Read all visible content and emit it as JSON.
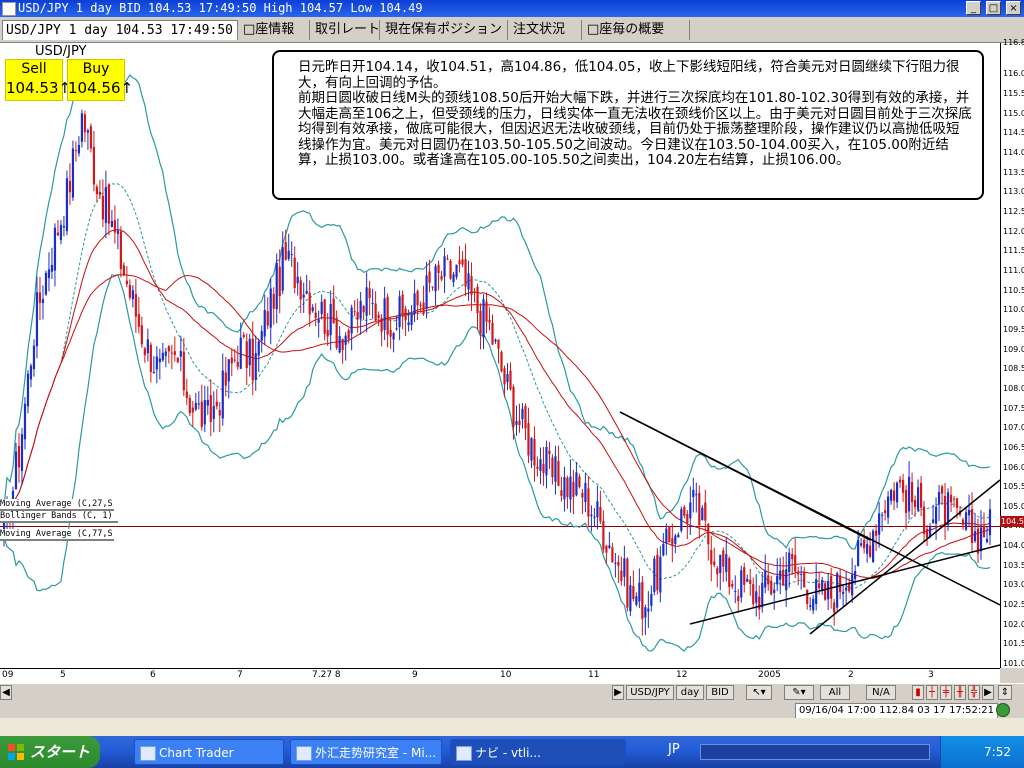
{
  "window": {
    "title": "USD/JPY 1 day BID 104.53 17:49:50 High 104.57 Low 104.49"
  },
  "tabs": [
    {
      "label": "USD/JPY 1 day 104.53 17:49:50"
    },
    {
      "label": "□座情報"
    },
    {
      "label": "取引レート"
    },
    {
      "label": "現在保有ポジション"
    },
    {
      "label": "注文状況"
    },
    {
      "label": "□座毎の概要"
    }
  ],
  "quote": {
    "symbol": "USD/JPY",
    "sell_label": "Sell",
    "sell_value": "104.53↑",
    "buy_label": "Buy",
    "buy_value": "104.56↑"
  },
  "note": {
    "paragraphs": [
      "日元昨日开104.14，收104.51，高104.86，低104.05，收上下影线短阳线，符合美元对日圆继续下行阻力很大，有向上回调的予估。",
      "前期日圆收破日线M头的颈线108.50后开始大幅下跌，并进行三次探底均在101.80-102.30得到有效的承接，并大幅走高至106之上，但受颈线的压力，日线实体一直无法收在颈线价区以上。由于美元对日圆目前处于三次探底均得到有效承接，做底可能很大，但因迟迟无法收破颈线，目前仍处于振荡整理阶段，操作建议仍以高抛低吸短线操作为宜。美元对日圆仍在103.50-105.50之间波动。今日建议在103.50-104.00买入，在105.00附近结算，止损103.00。或者逢高在105.00-105.50之间卖出，104.20左右结算，止损106.00。"
    ]
  },
  "indicators": [
    {
      "label": "Moving Average (C,27,S"
    },
    {
      "label": "Bollinger Bands (C, 1)"
    },
    {
      "label": "Moving Average (C,77,S"
    }
  ],
  "y_axis": {
    "ticks": [
      "116.8",
      "116.0",
      "115.5",
      "115.0",
      "114.5",
      "114.0",
      "113.5",
      "113.0",
      "112.5",
      "112.0",
      "111.5",
      "111.0",
      "110.5",
      "110.0",
      "109.5",
      "109.0",
      "108.5",
      "108.0",
      "107.5",
      "107.0",
      "106.5",
      "106.0",
      "105.5",
      "105.0",
      "104.5",
      "104.0",
      "103.5",
      "103.0",
      "102.5",
      "102.0",
      "101.5",
      "101.0"
    ],
    "current_price": "104.5"
  },
  "x_axis": {
    "ticks": [
      "09",
      "5",
      "6",
      "7",
      "7.27 8",
      "9",
      "10",
      "11",
      "12",
      "2005",
      "2",
      "3"
    ]
  },
  "chart_data": {
    "type": "candlestick",
    "symbol": "USD/JPY",
    "timeframe": "1 day",
    "ylim": [
      100.9,
      116.8
    ],
    "x_labels": [
      "09",
      "5",
      "6",
      "7",
      "7.27 8",
      "9",
      "10",
      "11",
      "12",
      "2005",
      "2",
      "3"
    ],
    "close_series": [
      104.2,
      106.5,
      109.8,
      111.5,
      112.9,
      115.0,
      113.2,
      112.0,
      110.5,
      109.2,
      108.4,
      108.8,
      107.6,
      107.2,
      108.0,
      109.1,
      108.6,
      110.2,
      111.3,
      110.8,
      110.1,
      109.6,
      109.4,
      110.2,
      110.0,
      109.8,
      109.9,
      110.5,
      110.9,
      111.0,
      110.2,
      109.6,
      108.2,
      107.1,
      106.4,
      105.8,
      105.6,
      105.4,
      104.7,
      103.8,
      102.8,
      102.6,
      103.6,
      104.6,
      105.1,
      104.2,
      103.4,
      103.0,
      102.8,
      103.0,
      103.6,
      103.2,
      102.7,
      102.8,
      103.4,
      103.9,
      105.0,
      105.6,
      105.2,
      104.7,
      105.0,
      104.6,
      104.3,
      104.5
    ],
    "indicators": [
      "Moving Average (C,27,S",
      "Bollinger Bands (C, 1)",
      "Moving Average (C,77,S"
    ],
    "current_price": 104.5
  },
  "toolbar": {
    "symbol": "USD/JPY",
    "timeframe": "day",
    "price_type": "BID",
    "all": "All",
    "na": "N/A"
  },
  "status": {
    "text": "09/16/04 17:00  112.84  03 17 17:52:21"
  },
  "taskbar": {
    "start": "スタート",
    "tasks": [
      {
        "label": "Chart Trader"
      },
      {
        "label": "外汇走势研究室 - Mi..."
      },
      {
        "label": "ナビ - vtli..."
      }
    ],
    "lang": "JP",
    "clock": "7:52"
  },
  "colors": {
    "bull_candle": "#1a2fc8",
    "bear_candle": "#d21818",
    "bollinger": "#2a9aa0",
    "ma": "#c81010",
    "trend_line": "#000000",
    "quote_bg": "#ffff00"
  }
}
